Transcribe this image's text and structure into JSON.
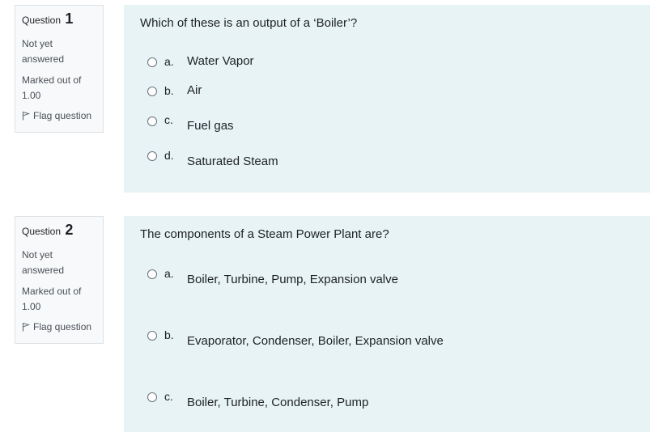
{
  "questions": [
    {
      "label": "Question",
      "number": "1",
      "state": "Not yet answered",
      "grade": "Marked out of 1.00",
      "flag": "Flag question",
      "text": "Which of these is an output of a ‘Boiler’?",
      "options": [
        {
          "letter": "a.",
          "text": "Water Vapor"
        },
        {
          "letter": "b.",
          "text": "Air"
        },
        {
          "letter": "c.",
          "text": "Fuel gas"
        },
        {
          "letter": "d.",
          "text": "Saturated Steam"
        }
      ]
    },
    {
      "label": "Question",
      "number": "2",
      "state": "Not yet answered",
      "grade": "Marked out of 1.00",
      "flag": "Flag question",
      "text": "The components of a Steam Power Plant are?",
      "options": [
        {
          "letter": "a.",
          "text": "Boiler, Turbine, Pump, Expansion valve"
        },
        {
          "letter": "b.",
          "text": "Evaporator, Condenser, Boiler, Expansion valve"
        },
        {
          "letter": "c.",
          "text": "Boiler, Turbine, Condenser, Pump"
        }
      ]
    }
  ]
}
